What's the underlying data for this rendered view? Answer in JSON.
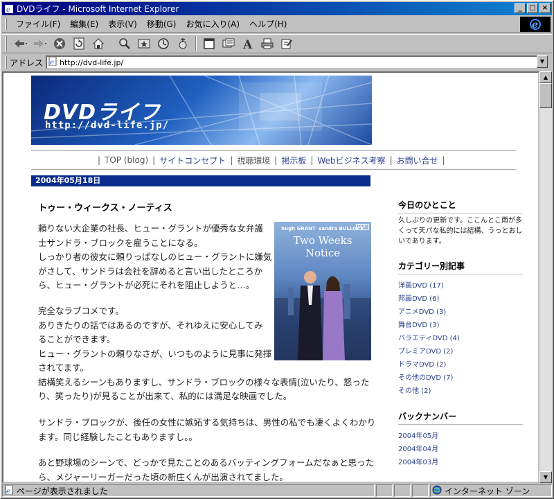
{
  "window": {
    "title": "DVDライフ - Microsoft Internet Explorer",
    "controls": [
      "_",
      "□",
      "×"
    ]
  },
  "menu": [
    "ファイル(F)",
    "編集(E)",
    "表示(V)",
    "移動(G)",
    "お気に入り(A)",
    "ヘルプ(H)"
  ],
  "toolbar": {
    "buttons": [
      "back-icon",
      "forward-icon",
      "stop-icon",
      "refresh-icon",
      "home-icon",
      "search-icon",
      "favorites-icon",
      "history-icon",
      "channels-icon",
      "fullscreen-icon",
      "mail-icon",
      "font-icon",
      "print-icon",
      "edit-icon"
    ]
  },
  "address": {
    "label": "アドレス",
    "value": "http://dvd-life.jp/"
  },
  "page": {
    "banner": {
      "title": "DVDライフ",
      "url": "http://dvd-life.jp/"
    },
    "nav": [
      "TOP (blog)",
      "サイトコンセプト",
      "視聴環境",
      "掲示板",
      "Webビジネス考察",
      "お問い合せ"
    ],
    "date": "2004年05月18日",
    "post_title": "トゥー・ウィークス・ノーティス",
    "dvd_cover": {
      "actor_left": "hugh GRANT",
      "actor_right": "sandra BULLOCK",
      "movie_title": "Two Weeks Notice",
      "tag": "DVD"
    },
    "paragraphs": [
      [
        "頼りない大企業の社長、ヒュー・グラントが優秀な女弁護",
        "士サンドラ・ブロックを雇うことになる。",
        "しっかり者の彼女に頼りっぱなしのヒュー・グラントに嫌気",
        "がさして、サンドラは会社を辞めると言い出したところか",
        "ら、ヒュー・グラントが必死にそれを阻止しようと…。"
      ],
      [
        "完全なラブコメです。",
        "ありきたりの話ではあるのですが、それゆえに安心してみ",
        "ることができます。",
        "ヒュー・グラントの頼りなさが、いつものように見事に発揮",
        "されてます。",
        "結構笑えるシーンもありますし、サンドラ・ブロックの様々な表情(泣いたり、怒った",
        "り、笑ったり)が見ることが出来て、私的には満足な映画でした。"
      ],
      [
        "サンドラ・ブロックが、後任の女性に嫉妬する気持ちは、男性の私でも凄くよくわかり",
        "ます。同じ経験したこともありますし。。"
      ],
      [
        "あと野球場のシーンで、どっかで見たことのあるバッティングフォームだなぁと思った",
        "ら、メジャーリーガーだった頃の新庄くんが出演されてました。"
      ]
    ],
    "sidebar": {
      "today_heading": "今日のひとこと",
      "today_text": [
        "久しぶりの更新です。ここんとこ雨が多",
        "くって天パな私的には結構、うっとおし",
        "いであります。"
      ],
      "category_heading": "カテゴリー別記事",
      "categories": [
        "洋画DVD (17)",
        "邦画DVD (6)",
        "アニメDVD (3)",
        "舞台DVD (3)",
        "バラエティDVD (4)",
        "プレミアDVD (2)",
        "ドラマDVD (2)",
        "その他のDVD (7)",
        "その他 (2)"
      ],
      "backnumber_heading": "バックナンバー",
      "backnumbers": [
        "2004年05月",
        "2004年04月",
        "2004年03月"
      ]
    }
  },
  "status": {
    "text": "ページが表示されました",
    "zone": "インターネット ゾーン"
  }
}
